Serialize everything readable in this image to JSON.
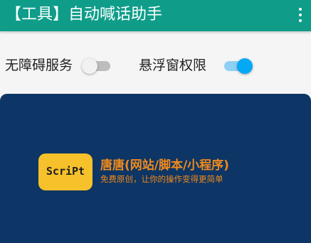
{
  "app_bar": {
    "title": "【工具】自动喊话助手",
    "menu_icon": "more-vert-icon",
    "background": "#0f9d8a"
  },
  "settings": {
    "accessibility": {
      "label": "无障碍服务",
      "enabled": false
    },
    "floating_window": {
      "label": "悬浮窗权限",
      "enabled": true,
      "accent": "#03a9f4"
    }
  },
  "banner": {
    "background": "#0d3565",
    "logo_text": "ScriPt",
    "logo_color": "#f6c12a",
    "brand_name": "唐唐(网站/脚本/小程序)",
    "slogan": "免费原创，让你的操作变得更简单",
    "brand_color": "#f08a1c"
  }
}
